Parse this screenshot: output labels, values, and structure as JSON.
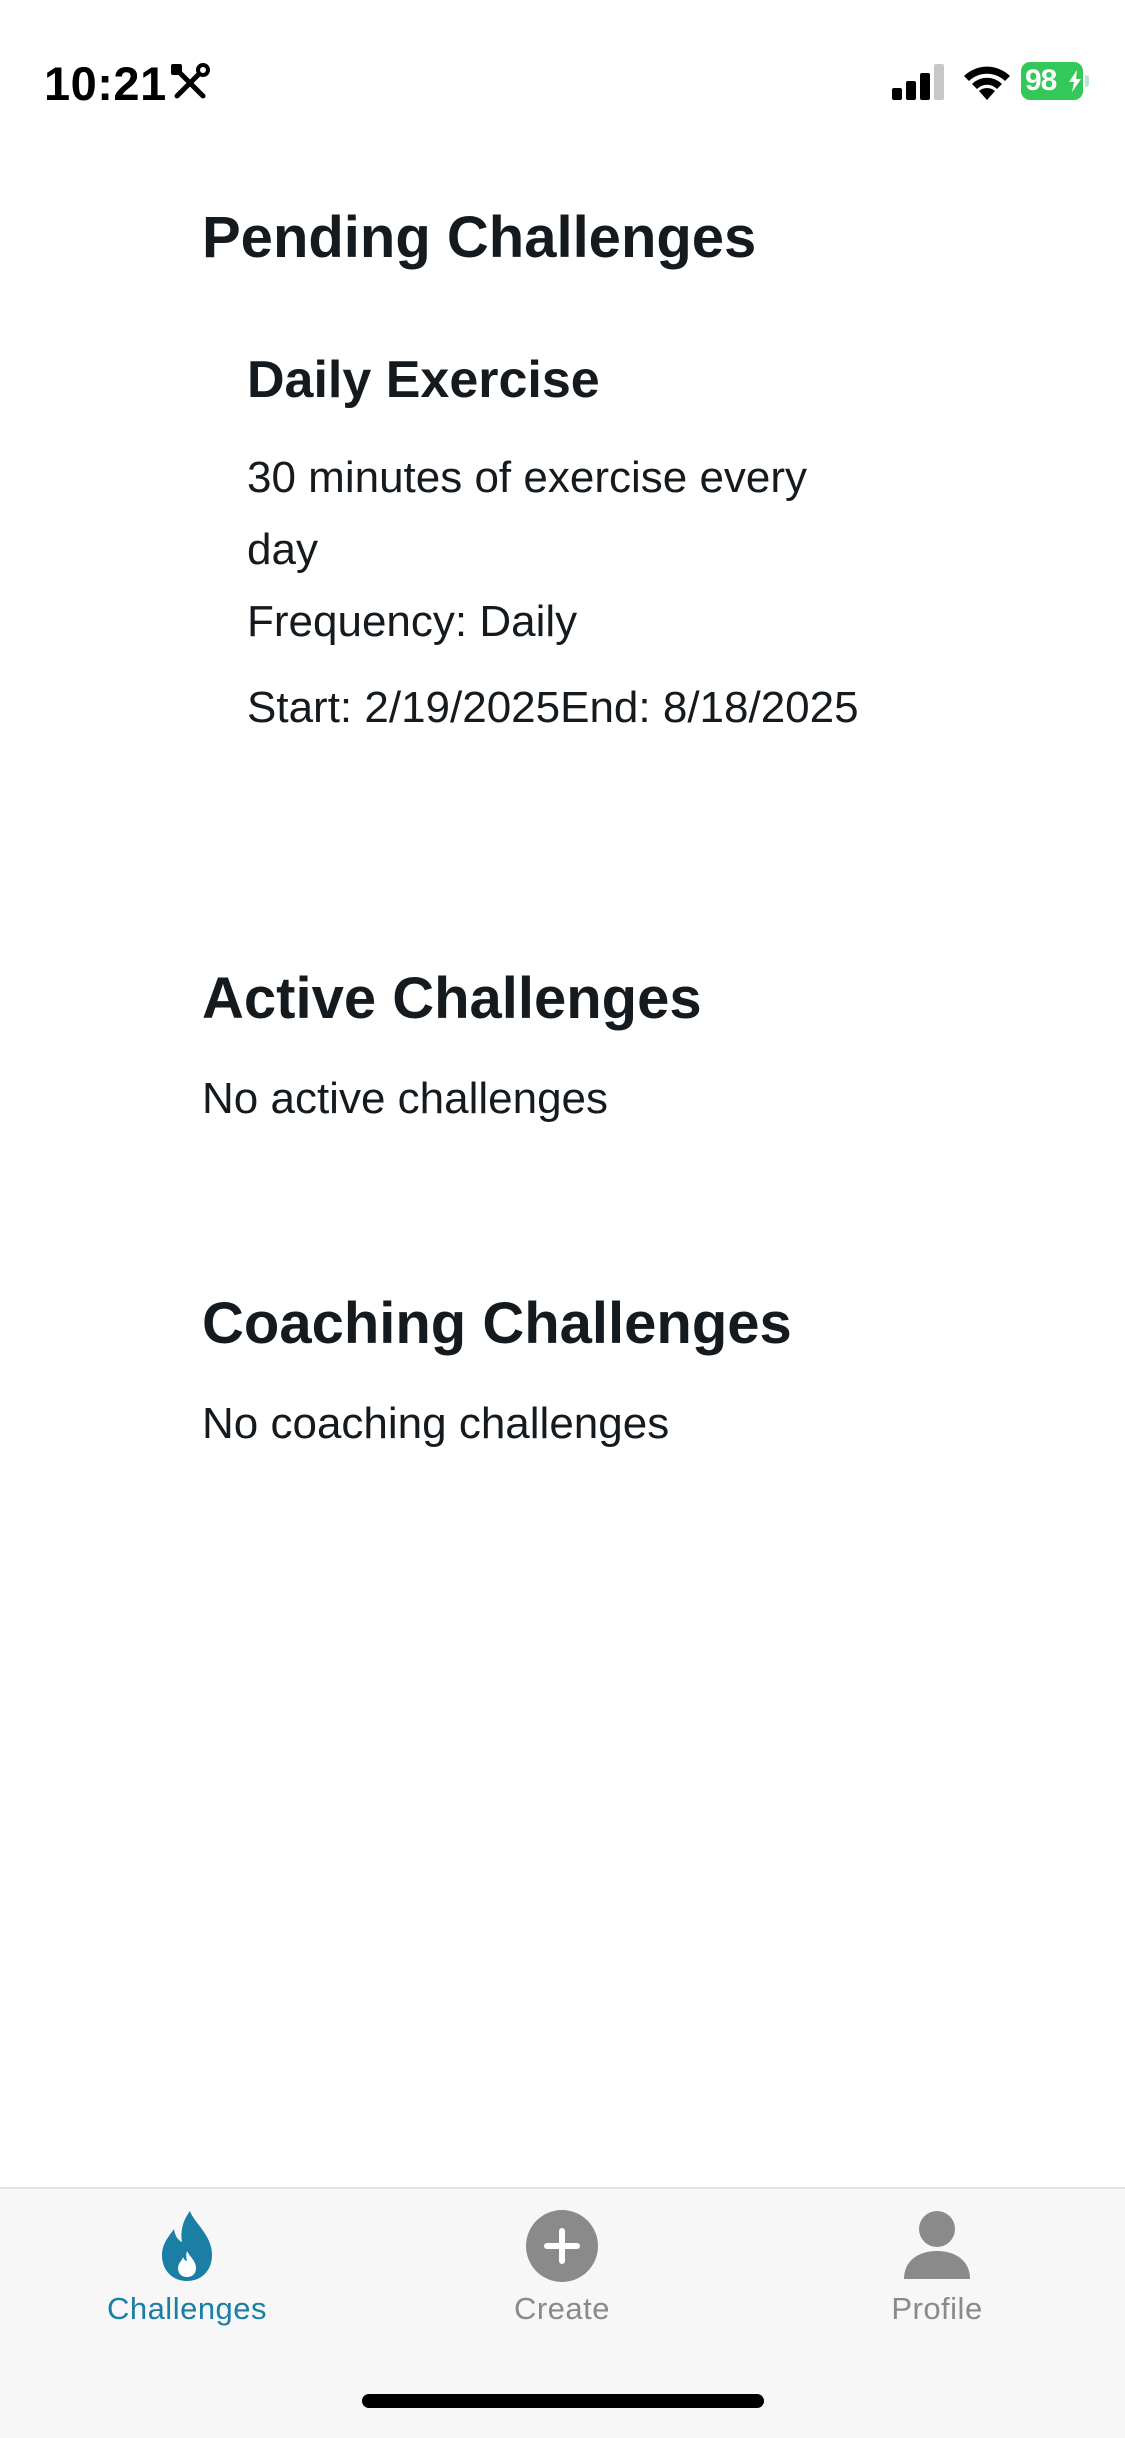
{
  "status_bar": {
    "time": "10:21",
    "battery": "98"
  },
  "sections": {
    "pending": {
      "title": "Pending Challenges",
      "card": {
        "title": "Daily Exercise",
        "description": "30 minutes of exercise every day",
        "frequency": "Frequency: Daily",
        "dates": "Start: 2/19/2025End: 8/18/2025"
      }
    },
    "active": {
      "title": "Active Challenges",
      "empty": "No active challenges"
    },
    "coaching": {
      "title": "Coaching Challenges",
      "empty": "No coaching challenges"
    }
  },
  "tabs": [
    {
      "label": "Challenges",
      "icon": "flame-icon",
      "active": true
    },
    {
      "label": "Create",
      "icon": "plus-circle-icon",
      "active": false
    },
    {
      "label": "Profile",
      "icon": "person-icon",
      "active": false
    }
  ],
  "colors": {
    "accent": "#1a7ea5",
    "inactive": "#8a8a8a",
    "battery": "#34c759"
  }
}
